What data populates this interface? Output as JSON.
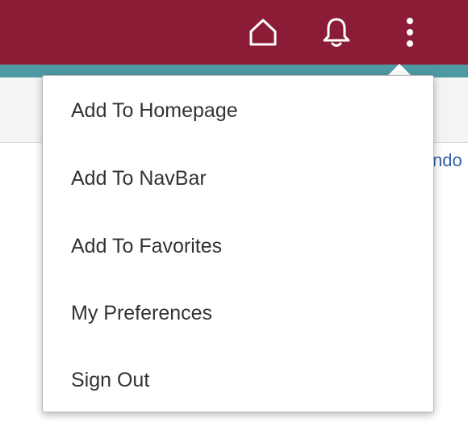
{
  "header": {
    "background_color": "#8b1c35",
    "stripe_color": "#4e99a3",
    "icons": {
      "home": "home-icon",
      "notifications": "bell-icon",
      "actions": "more-vertical-icon"
    }
  },
  "background": {
    "link_fragment": "ndo",
    "link_color": "#2f5fa8"
  },
  "menu": {
    "items": [
      {
        "label": "Add To Homepage"
      },
      {
        "label": "Add To NavBar"
      },
      {
        "label": "Add To Favorites"
      },
      {
        "label": "My Preferences"
      },
      {
        "label": "Sign Out"
      }
    ]
  }
}
